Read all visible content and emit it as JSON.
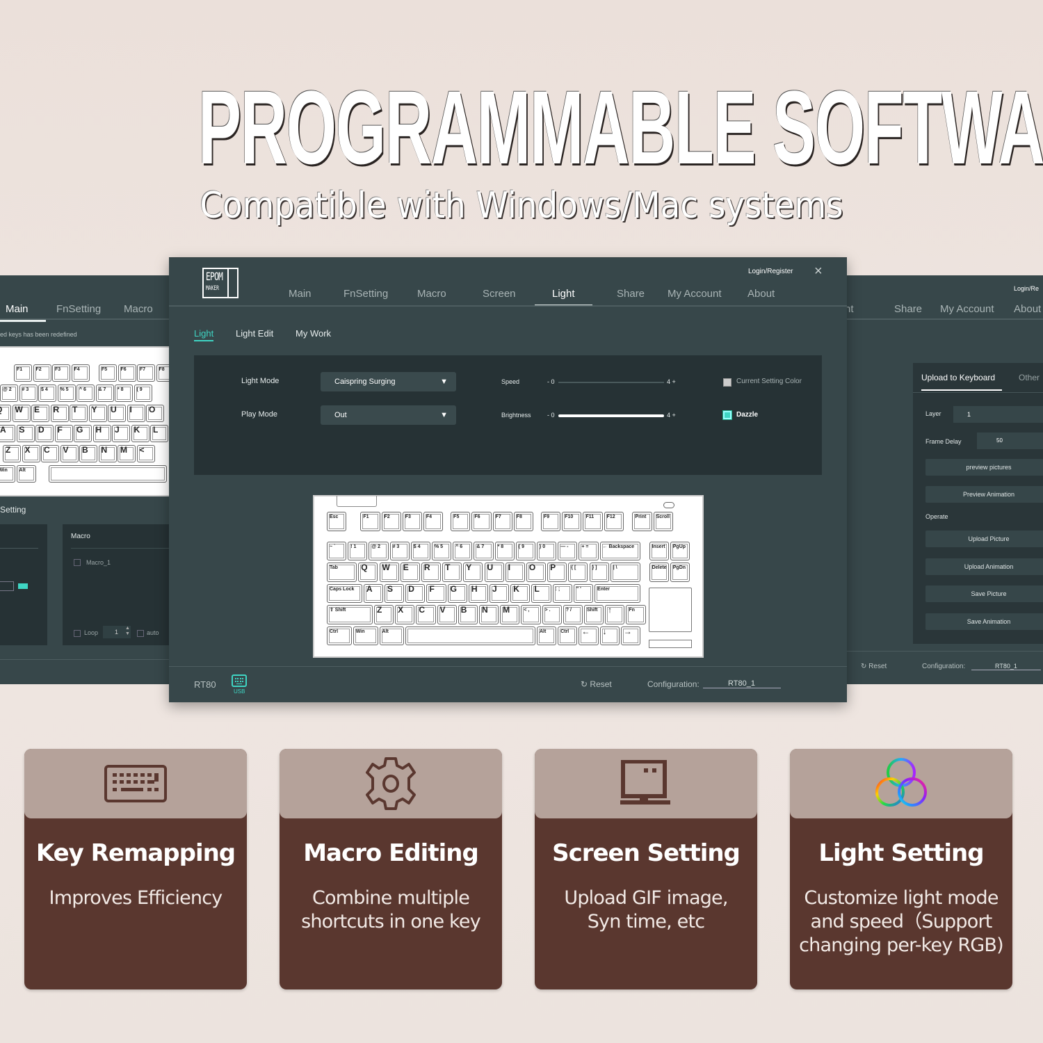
{
  "hero": {
    "title": "PROGRAMMABLE SOFTWARE",
    "subtitle": "Compatible with Windows/Mac systems"
  },
  "left_window": {
    "nav": [
      "Main",
      "FnSetting",
      "Macro"
    ],
    "active_nav": "Main",
    "notice": "ed keys has been redefined",
    "section_label": "Setting",
    "macro_panel": {
      "title": "Macro",
      "items": [
        "Macro_1"
      ],
      "loop_label": "Loop",
      "loop_value": "1",
      "auto_label": "auto"
    },
    "keyboard_rows": [
      [
        "F1",
        "F2",
        "F3",
        "F4",
        "F5",
        "F6",
        "F7",
        "F8"
      ],
      [
        "@ 2",
        "# 3",
        "$ 4",
        "% 5",
        "^ 6",
        "& 7",
        "* 8",
        "( 9"
      ],
      [
        "Q",
        "W",
        "E",
        "R",
        "T",
        "Y",
        "U",
        "I",
        "O"
      ],
      [
        "A",
        "S",
        "D",
        "F",
        "G",
        "H",
        "J",
        "K",
        "L"
      ],
      [
        "Z",
        "X",
        "C",
        "V",
        "B",
        "N",
        "M",
        "<"
      ],
      [
        "Win",
        "Alt"
      ]
    ]
  },
  "main_window": {
    "logo_line1": "EPOM",
    "logo_line2": "MAKER",
    "login": "Login/Register",
    "close_icon": "×",
    "nav": [
      "Main",
      "FnSetting",
      "Macro",
      "Screen",
      "Light",
      "Share",
      "My Account",
      "About"
    ],
    "active_nav": "Light",
    "subtabs": [
      "Light",
      "Light Edit",
      "My Work"
    ],
    "active_subtab": "Light",
    "settings": {
      "light_mode_label": "Light Mode",
      "light_mode_value": "Caispring Surging",
      "play_mode_label": "Play Mode",
      "play_mode_value": "Out",
      "dropdown_arrow": "▼",
      "speed_label": "Speed",
      "speed_min": "- 0",
      "speed_max": "4 +",
      "speed_value": 0,
      "brightness_label": "Brightness",
      "brightness_min": "- 0",
      "brightness_max": "4 +",
      "brightness_value": 4,
      "current_color_label": "Current Setting Color",
      "current_color_checked": false,
      "dazzle_label": "Dazzle",
      "dazzle_checked": true
    },
    "keyboard": {
      "rows": [
        [
          "Esc",
          "F1",
          "F2",
          "F3",
          "F4",
          "F5",
          "F6",
          "F7",
          "F8",
          "F9",
          "F10",
          "F11",
          "F12",
          "Print",
          "Scroll"
        ],
        [
          "~ `",
          "! 1",
          "@ 2",
          "# 3",
          "$ 4",
          "% 5",
          "^ 6",
          "& 7",
          "* 8",
          "( 9",
          ") 0",
          "— -",
          "+ =",
          "← Backspace",
          "Insert",
          "PgUp"
        ],
        [
          "Tab",
          "Q",
          "W",
          "E",
          "R",
          "T",
          "Y",
          "U",
          "I",
          "O",
          "P",
          "{ [",
          "} ]",
          "| \\",
          "Delete",
          "PgDn"
        ],
        [
          "Caps Lock",
          "A",
          "S",
          "D",
          "F",
          "G",
          "H",
          "J",
          "K",
          "L",
          ": ;",
          "\" '",
          "Enter"
        ],
        [
          "⇧ Shift",
          "Z",
          "X",
          "C",
          "V",
          "B",
          "N",
          "M",
          "< ,",
          "> .",
          "? /",
          "Shift",
          "↑",
          "Fn"
        ],
        [
          "Ctrl",
          "Win",
          "Alt",
          "",
          "Alt",
          "Ctrl",
          "←",
          "↓",
          "→"
        ]
      ]
    },
    "footer": {
      "device": "RT80",
      "connection": "USB",
      "reset": "Reset",
      "config_label": "Configuration:",
      "config_value": "RT80_1"
    }
  },
  "right_window": {
    "nav": [
      "ht",
      "Share",
      "My Account",
      "About"
    ],
    "login": "Login/Re",
    "tabs": [
      "Upload to Keyboard",
      "Other"
    ],
    "active_tab": "Upload to Keyboard",
    "layer_label": "Layer",
    "layer_value": "1",
    "frame_delay_label": "Frame Delay",
    "frame_delay_value": "50",
    "preview_pictures": "preview pictures",
    "preview_animation": "Preview Animation",
    "operate_label": "Operate",
    "buttons": [
      "Upload Picture",
      "Upload Animation",
      "Save Picture",
      "Save Animation"
    ],
    "reset": "Reset",
    "config_label": "Configuration:",
    "config_value": "RT80_1"
  },
  "features": [
    {
      "icon": "keyboard-icon",
      "title": "Key Remapping",
      "desc": "Improves Efficiency"
    },
    {
      "icon": "gear-icon",
      "title": "Macro Editing",
      "desc": "Combine multiple\nshortcuts in one key"
    },
    {
      "icon": "monitor-icon",
      "title": "Screen Setting",
      "desc": "Upload GIF image,\nSyn time, etc"
    },
    {
      "icon": "rgb-rings-icon",
      "title": "Light Setting",
      "desc": "Customize light mode\nand speed（Support\nchanging per-key RGB)"
    }
  ],
  "colors": {
    "accent": "#3fd6c4",
    "window_bg": "#37474a",
    "panel_bg": "#263235",
    "card_bottom": "#5a372f",
    "card_top": "#b5a29a"
  }
}
